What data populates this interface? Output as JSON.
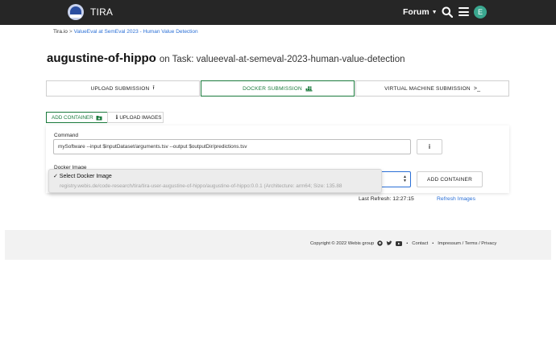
{
  "header": {
    "brand": "TIRA",
    "forum_label": "Forum",
    "avatar_letter": "E",
    "colors": {
      "bar": "#262626",
      "avatar": "#3aa78f"
    }
  },
  "breadcrumb": {
    "home": "Tira.io",
    "separator": ">",
    "current": "ValueEval at SemEval 2023 - Human Value Detection"
  },
  "page": {
    "title": "augustine-of-hippo",
    "subtitle": "on Task: valueeval-at-semeval-2023-human-value-detection"
  },
  "tabs": [
    {
      "label": "UPLOAD SUBMISSION",
      "icon": "upload-icon"
    },
    {
      "label": "DOCKER SUBMISSION",
      "icon": "docker-icon",
      "active": true
    },
    {
      "label": "VIRTUAL MACHINE SUBMISSION",
      "icon": "terminal-icon"
    }
  ],
  "subtabs": [
    {
      "label": "ADD CONTAINER",
      "icon": "folder-plus-icon",
      "active": true
    },
    {
      "label": "UPLOAD IMAGES",
      "icon": "info-icon"
    }
  ],
  "form": {
    "command_label": "Command",
    "command_value": "mySoftware --input $inputDataset/arguments.tsv --output $outputDir/predictions.tsv",
    "info_button": "i",
    "docker_image_label": "Docker Image",
    "add_container_button": "ADD CONTAINER",
    "dropdown_options": [
      "✓ Select Docker Image",
      "registry.webis.de/code-research/tira/tira-user-augustine-of-hippo/augustine-of-hippo:0.0.1 (Architecture: arm64; Size: 135.88"
    ],
    "last_refresh": "Last Refresh: 12:27:15",
    "refresh_link": "Refresh Images"
  },
  "footer": {
    "copyright": "Copyright © 2022 Webis group",
    "contact": "Contact",
    "links": "Impressum / Terms / Privacy",
    "icons": [
      "github-icon",
      "twitter-icon",
      "youtube-icon"
    ]
  },
  "accent_colors": {
    "green": "#1a7a3c",
    "link": "#2a6fd6"
  }
}
